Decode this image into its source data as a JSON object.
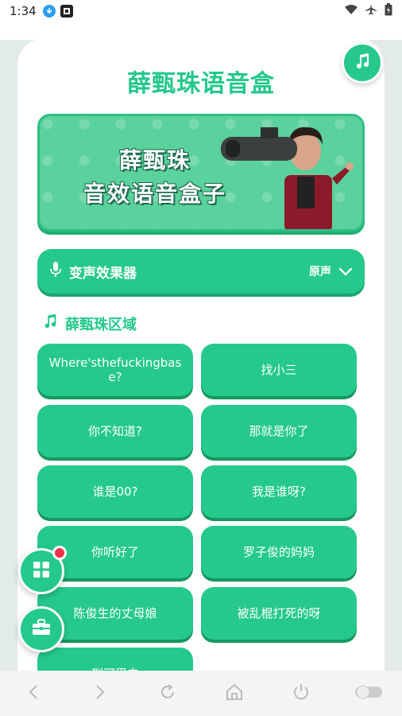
{
  "status_bar": {
    "time": "1:34",
    "icons": [
      "download-icon",
      "app-icon",
      "wifi-icon",
      "airplane-icon",
      "battery-icon"
    ]
  },
  "app": {
    "title": "薛甄珠语音盒",
    "accent_color": "#25c98b",
    "banner": {
      "line1": "薛甄珠",
      "line2": "音效语音盒子"
    },
    "voice_changer": {
      "label": "变声效果器",
      "value": "原声"
    },
    "section": {
      "title": "薛甄珠区域"
    },
    "sound_buttons": [
      "Where'sthefuckingbase?",
      "找小三",
      "你不知道?",
      "那就是你了",
      "谁是00?",
      "我是谁呀?",
      "你听好了",
      "罗子俊的妈妈",
      "陈俊生的丈母娘",
      "被乱棍打死的呀",
      "到河里去"
    ]
  },
  "navbar": {
    "icons": [
      "back-icon",
      "forward-icon",
      "refresh-icon",
      "home-icon",
      "power-icon",
      "toggle-icon"
    ]
  }
}
